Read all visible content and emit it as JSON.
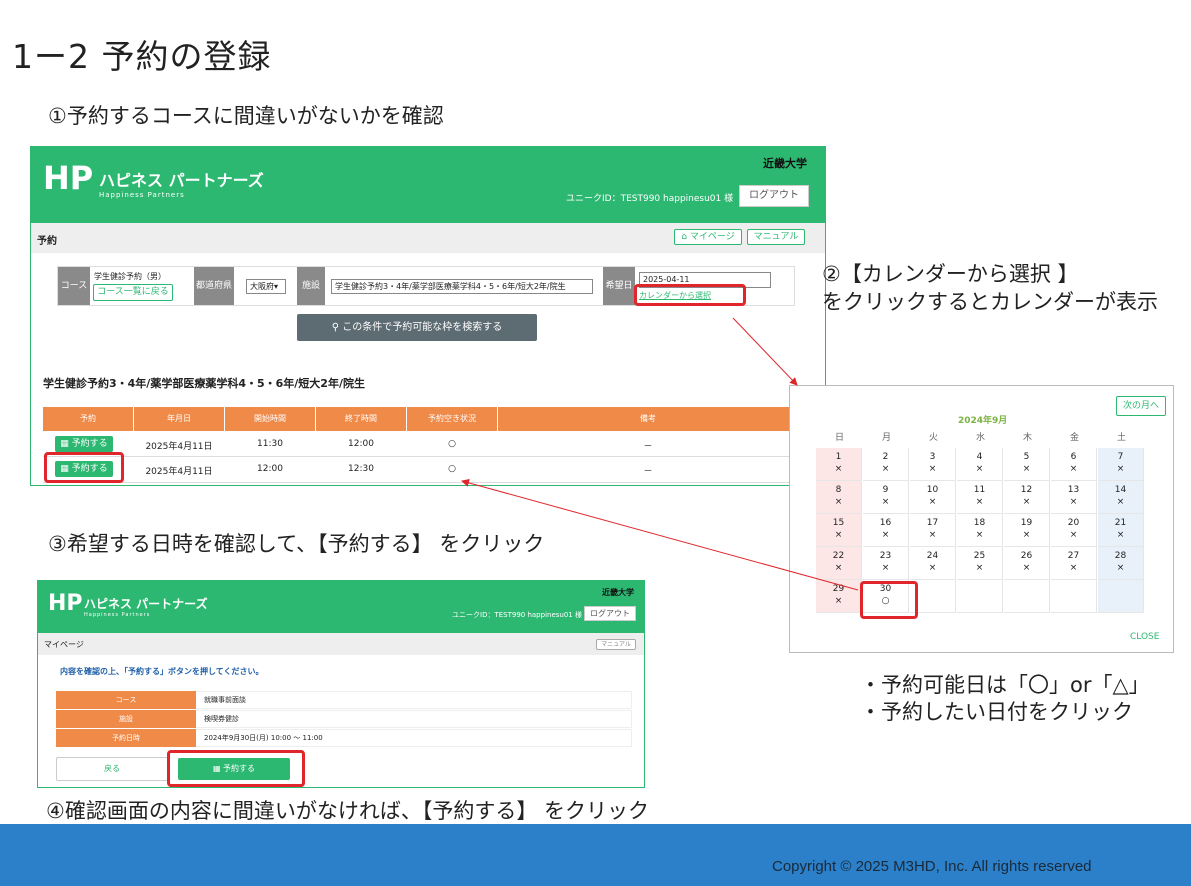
{
  "slide": {
    "title": "1ー2  予約の登録",
    "step1": "①予約するコースに間違いがないかを確認",
    "step2_line1": "②【カレンダーから選択 】",
    "step2_line2": "をクリックするとカレンダーが表示",
    "step3": "③希望する日時を確認して、【予約する】 をクリック",
    "step4": "④確認画面の内容に間違いがなければ、【予約する】 をクリック",
    "note1": "・予約可能日は「〇」or「△」",
    "note2": "・予約したい日付をクリック",
    "copyright": "Copyright © 2025  M3HD, Inc.  All rights reserved"
  },
  "shot1": {
    "logo": "ハピネス パートナーズ",
    "logo_sub": "Happiness Partners",
    "university": "近畿大学",
    "user_info": "ユニークID：TEST990    happinesu01 様",
    "logout": "ログアウト",
    "page_title": "予約",
    "mypage_btn": "マイページ",
    "manual_btn": "マニュアル",
    "course_label": "コース",
    "course_value": "学生健診予約（男）",
    "course_back_btn": "コース一覧に戻る",
    "pref_label": "都道府県",
    "pref_value": "大阪府",
    "facility_label": "施設",
    "facility_value": "学生健診予約3・4年/薬学部医療薬学科4・5・6年/短大2年/院生",
    "date_label": "希望日",
    "date_value": "2025-04-11",
    "calendar_link": "カレンダーから選択",
    "search_btn": "この条件で予約可能な枠を検索する",
    "section_title": "学生健診予約3・4年/薬学部医療薬学科4・5・6年/短大2年/院生",
    "table_headers": [
      "予約",
      "年月日",
      "開始時間",
      "終了時間",
      "予約空き状況",
      "備考"
    ],
    "rows": [
      {
        "btn": "予約する",
        "date": "2025年4月11日",
        "start": "11:30",
        "end": "12:00",
        "status": "○",
        "note": "－"
      },
      {
        "btn": "予約する",
        "date": "2025年4月11日",
        "start": "12:00",
        "end": "12:30",
        "status": "○",
        "note": "－"
      }
    ]
  },
  "calendar": {
    "next_btn": "次の月へ",
    "month": "2024年9月",
    "weekdays": [
      "日",
      "月",
      "火",
      "水",
      "木",
      "金",
      "土"
    ],
    "mark_x": "×",
    "mark_o": "○",
    "close": "CLOSE"
  },
  "shot2": {
    "logo": "ハピネス パートナーズ",
    "logo_sub": "Happiness Partners",
    "university": "近畿大学",
    "user_info": "ユニークID：TEST990    happinesu01 様",
    "logout": "ログアウト",
    "page_title": "マイページ",
    "manual_btn": "マニュアル",
    "instruction": "内容を確認の上、「予約する」ボタンを押してください。",
    "rows": [
      {
        "label": "コース",
        "value": "就職事前面談"
      },
      {
        "label": "施設",
        "value": "検喫券健診"
      },
      {
        "label": "予約日時",
        "value": "2024年9月30日(月) 10:00 ～ 11:00"
      }
    ],
    "back_btn": "戻る",
    "reserve_btn": "予約する"
  },
  "colors": {
    "brand_green": "#2db872",
    "table_orange": "#ef8a49",
    "highlight_red": "#e0262b",
    "footer_blue": "#2b80c9"
  }
}
